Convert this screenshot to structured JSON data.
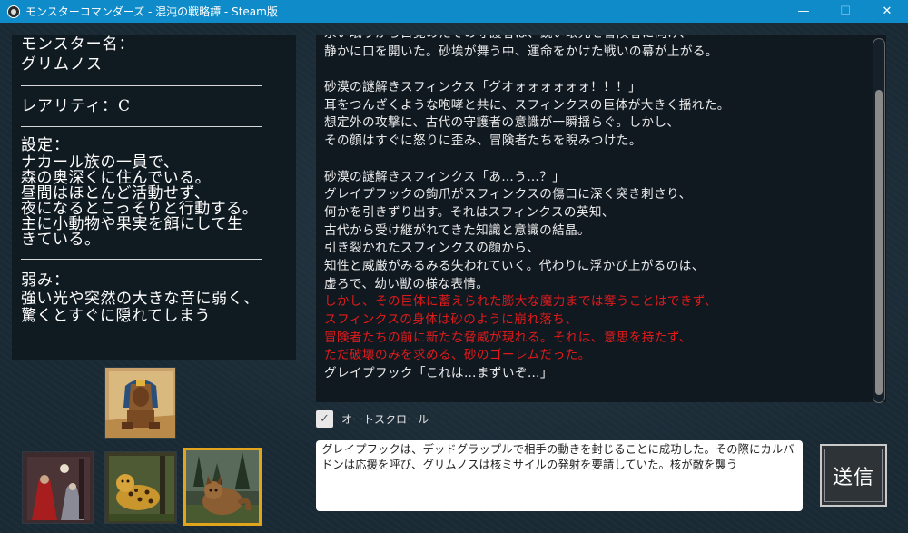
{
  "window": {
    "title": "モンスターコマンダーズ - 混沌の戦略譚 - Steam版",
    "minimize": "—",
    "maximize": "☐",
    "close": "✕"
  },
  "monster": {
    "name_label": "モンスター名：",
    "name": "グリムノス",
    "rarity": "レアリティ：C",
    "setting_label": "設定：",
    "setting_lines": [
      "ナカール族の一員で、",
      "森の奥深くに住んでいる。",
      "昼間はほとんど活動せず、",
      "夜になるとこっそりと行動する。",
      "主に小動物や果実を餌にして生",
      "きている。"
    ],
    "weakness_label": "弱み：",
    "weakness_lines": [
      "強い光や突然の大きな音に弱く、",
      "驚くとすぐに隠れてしまう"
    ]
  },
  "story": {
    "lines": [
      {
        "text": "永い眠りから目覚めたその守護者は、鋭い眼光を冒険者に向け、",
        "red": false
      },
      {
        "text": "静かに口を開いた。砂埃が舞う中、運命をかけた戦いの幕が上がる。",
        "red": false
      },
      {
        "text": "",
        "red": false
      },
      {
        "text": "砂漠の謎解きスフィンクス「グオォォォォォォ！！！」",
        "red": false
      },
      {
        "text": "耳をつんざくような咆哮と共に、スフィンクスの巨体が大きく揺れた。",
        "red": false
      },
      {
        "text": "想定外の攻撃に、古代の守護者の意識が一瞬揺らぐ。しかし、",
        "red": false
      },
      {
        "text": "その顔はすぐに怒りに歪み、冒険者たちを睨みつけた。",
        "red": false
      },
      {
        "text": "",
        "red": false
      },
      {
        "text": "砂漠の謎解きスフィンクス「あ…う…？」",
        "red": false
      },
      {
        "text": "グレイプフックの鉤爪がスフィンクスの傷口に深く突き刺さり、",
        "red": false
      },
      {
        "text": "何かを引きずり出す。それはスフィンクスの英知、",
        "red": false
      },
      {
        "text": "古代から受け継がれてきた知識と意識の結晶。",
        "red": false
      },
      {
        "text": "引き裂かれたスフィンクスの顔から、",
        "red": false
      },
      {
        "text": "知性と威厳がみるみる失われていく。代わりに浮かび上がるのは、",
        "red": false
      },
      {
        "text": "虚ろで、幼い獣の様な表情。",
        "red": false
      },
      {
        "text": "しかし、その巨体に蓄えられた膨大な魔力までは奪うことはできず、",
        "red": true
      },
      {
        "text": "スフィンクスの身体は砂のように崩れ落ち、",
        "red": true
      },
      {
        "text": "冒険者たちの前に新たな脅威が現れる。それは、意思を持たず、",
        "red": true
      },
      {
        "text": "ただ破壊のみを求める、砂のゴーレムだった。",
        "red": true
      },
      {
        "text": "グレイプフック「これは…まずいぞ…」",
        "red": false
      }
    ],
    "scroll_position": 0.14
  },
  "controls": {
    "autoscroll_label": "オートスクロール",
    "autoscroll_checked": true,
    "check_glyph": "✓",
    "input_value": "グレイプフックは、デッドグラップルで相手の動きを封じることに成功した。その際にカルバドンは応援を呼び、グリムノスは核ミサイルの発射を要請していた。核が敵を襲う",
    "send_label": "送信"
  },
  "portraits": {
    "selected": "lynx-beast",
    "items": [
      {
        "name": "sphinx"
      },
      {
        "name": "red-hooded-figures"
      },
      {
        "name": "leopard"
      },
      {
        "name": "lynx-beast"
      }
    ]
  },
  "colors": {
    "titlebar": "#0f8bc9",
    "highlight_text": "#e11b1b",
    "selected_border": "#e0a51c"
  }
}
